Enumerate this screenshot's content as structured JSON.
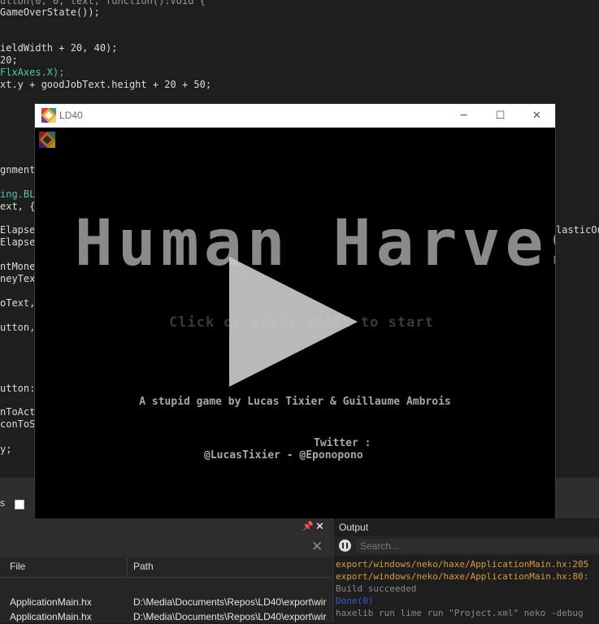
{
  "editor": {
    "lines": [
      {
        "text": "utton(0, 0, text, function():Void {",
        "cls": "dim"
      },
      {
        "text": "GameOverState());",
        "cls": ""
      },
      {
        "text": "ieldWidth + 20, 40);",
        "cls": ""
      },
      {
        "text": "20;",
        "cls": ""
      },
      {
        "text": "FlxAxes.X);",
        "cls": "ident"
      },
      {
        "text": "xt.y + goodJobText.height + 20 + 50;",
        "cls": ""
      },
      {
        "text": "gnment",
        "cls": ""
      },
      {
        "text": "ing.BL",
        "cls": "ident"
      },
      {
        "text": "ext, {x",
        "cls": ""
      },
      {
        "text": "Elapsed",
        "cls": ""
      },
      {
        "text": "Elapsed",
        "cls": ""
      },
      {
        "text": "ntMoney",
        "cls": ""
      },
      {
        "text": "neyText",
        "cls": ""
      },
      {
        "text": "oText,",
        "cls": ""
      },
      {
        "text": "utton,",
        "cls": ""
      },
      {
        "text": "utton:",
        "cls": ""
      },
      {
        "text": "nToActi",
        "cls": ""
      },
      {
        "text": "conToSp",
        "cls": ""
      },
      {
        "text": "y;",
        "cls": ""
      }
    ],
    "right_fragment": "lasticOu",
    "toolbar_fragment": "s"
  },
  "window": {
    "title": "LD40",
    "minimize_glyph": "─",
    "maximize_glyph": "☐",
    "close_glyph": "✕"
  },
  "game": {
    "title": "ot Human Harves",
    "start_prompt": "Click or press SPACE to start",
    "credits": "A stupid game by Lucas Tixier & Guillaume Ambrois",
    "twitter_label": "Twitter :",
    "twitter_handles": "@LucasTixier - @Eponopono"
  },
  "error_list": {
    "pin_glyph": "📌",
    "close_glyph": "✕",
    "clear_glyph": "✕",
    "columns": [
      "File",
      "Path"
    ],
    "rows": [
      {
        "file": "ApplicationMain.hx",
        "path": "D:\\Media\\Documents\\Repos\\LD40\\export\\wir"
      },
      {
        "file": "ApplicationMain.hx",
        "path": "D:\\Media\\Documents\\Repos\\LD40\\export\\wir"
      }
    ]
  },
  "output": {
    "title": "Output",
    "search_placeholder": "Search...",
    "lines": [
      {
        "text": "export/windows/neko/haxe/ApplicationMain.hx:205",
        "color": "#d69d3a"
      },
      {
        "text": "export/windows/neko/haxe/ApplicationMain.hx:80:",
        "color": "#d69d3a"
      },
      {
        "text": "Build succeeded",
        "color": "#8a8a8a"
      },
      {
        "text": "Done(0)",
        "color": "#3b5bdb"
      },
      {
        "text": "haxelib run lime run \"Project.xml\" neko -debug",
        "color": "#8a8a8a"
      }
    ]
  }
}
